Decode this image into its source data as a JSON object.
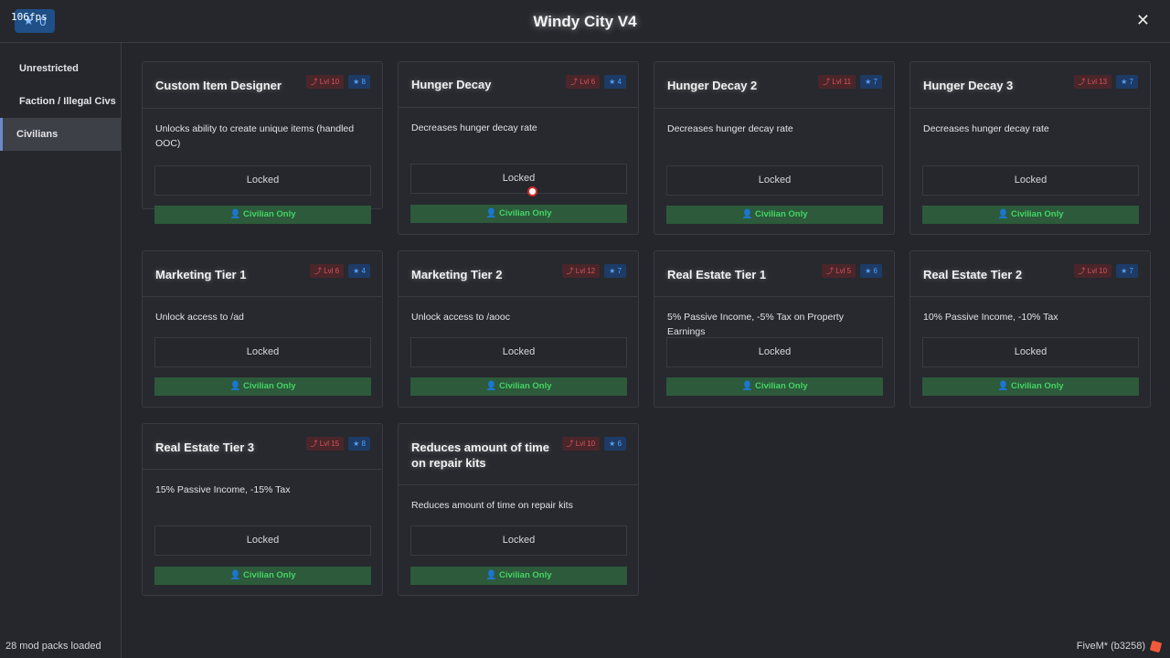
{
  "fps": "106fps",
  "app_title": "Windy City V4",
  "close_label": "✕",
  "star_count": "0",
  "sidebar": {
    "items": [
      {
        "label": "Unrestricted",
        "active": false
      },
      {
        "label": "Faction / Illegal Civs",
        "active": false
      },
      {
        "label": "Civilians",
        "active": true
      }
    ]
  },
  "cards": [
    {
      "title": "Custom Item Designer",
      "level": "Lvl 10",
      "stars": "8",
      "description": "Unlocks ability to create unique items (handled OOC)",
      "status": "Locked",
      "restriction": "Civilian Only"
    },
    {
      "title": "Hunger Decay",
      "level": "Lvl 6",
      "stars": "4",
      "description": "Decreases hunger decay rate",
      "status": "Locked",
      "restriction": "Civilian Only"
    },
    {
      "title": "Hunger Decay 2",
      "level": "Lvl 11",
      "stars": "7",
      "description": "Decreases hunger decay rate",
      "status": "Locked",
      "restriction": "Civilian Only"
    },
    {
      "title": "Hunger Decay 3",
      "level": "Lvl 13",
      "stars": "7",
      "description": "Decreases hunger decay rate",
      "status": "Locked",
      "restriction": "Civilian Only"
    },
    {
      "title": "Marketing Tier 1",
      "level": "Lvl 6",
      "stars": "4",
      "description": "Unlock access to /ad",
      "status": "Locked",
      "restriction": "Civilian Only"
    },
    {
      "title": "Marketing Tier 2",
      "level": "Lvl 12",
      "stars": "7",
      "description": "Unlock access to /aooc",
      "status": "Locked",
      "restriction": "Civilian Only"
    },
    {
      "title": "Real Estate Tier 1",
      "level": "Lvl 5",
      "stars": "6",
      "description": "5% Passive Income, -5% Tax on Property Earnings",
      "status": "Locked",
      "restriction": "Civilian Only"
    },
    {
      "title": "Real Estate Tier 2",
      "level": "Lvl 10",
      "stars": "7",
      "description": "10% Passive Income, -10% Tax",
      "status": "Locked",
      "restriction": "Civilian Only"
    },
    {
      "title": "Real Estate Tier 3",
      "level": "Lvl 15",
      "stars": "8",
      "description": "15% Passive Income, -15% Tax",
      "status": "Locked",
      "restriction": "Civilian Only"
    },
    {
      "title": "Reduces amount of time on repair kits",
      "level": "Lvl 10",
      "stars": "6",
      "description": "Reduces amount of time on repair kits",
      "status": "Locked",
      "restriction": "Civilian Only"
    }
  ],
  "footer": {
    "left": "28 mod packs loaded",
    "right": "FiveM* (b3258)"
  },
  "colors": {
    "background": "#24262b",
    "level_badge": "#d9545b",
    "star_badge": "#5aa0f0",
    "civilian_badge": "#44d465",
    "sidebar_active": "#3d4047"
  }
}
